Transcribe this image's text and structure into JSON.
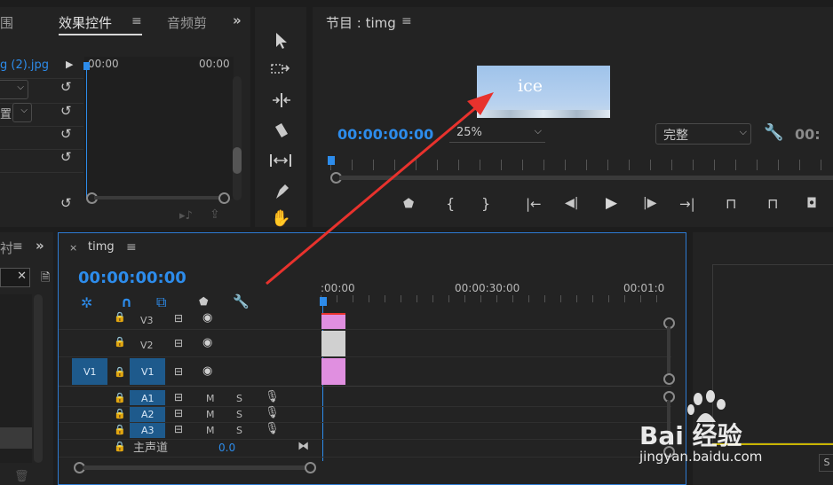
{
  "effects_panel": {
    "tab_left": "围",
    "tab_effects": "效果控件",
    "tab_audio": "音频剪",
    "clip_name": "g (2).jpg",
    "ruler_start": "00:00",
    "ruler_end": "00:00",
    "row_label_2": "置"
  },
  "program_monitor": {
    "title": "节目 : timg",
    "preview_text": "ice",
    "timecode": "00:00:00:00",
    "zoom": "25%",
    "quality": "完整",
    "timecode_right": "00:"
  },
  "timeline": {
    "tab_title": "timg",
    "timecode": "00:00:00:00",
    "ruler_labels": [
      ":00:00",
      "00:00:30:00",
      "00:01:0"
    ],
    "tracks": {
      "v3": "V3",
      "v2": "V2",
      "v1_source": "V1",
      "v1": "V1",
      "a1": "A1",
      "a2": "A2",
      "a3": "A3",
      "mute": "M",
      "solo": "S",
      "master_label": "主声道",
      "master_value": "0.0"
    }
  },
  "project_panel": {
    "tab_partial": "衬"
  },
  "watermark": {
    "brand": "Bai 经验",
    "url": "jingyan.baidu.com"
  },
  "colors": {
    "accent_blue": "#2d8ceb",
    "clip_pink": "#e08fe0",
    "clip_gray": "#d0d0d0",
    "arrow_red": "#e8322d",
    "track_blue": "#1e5a8c"
  }
}
